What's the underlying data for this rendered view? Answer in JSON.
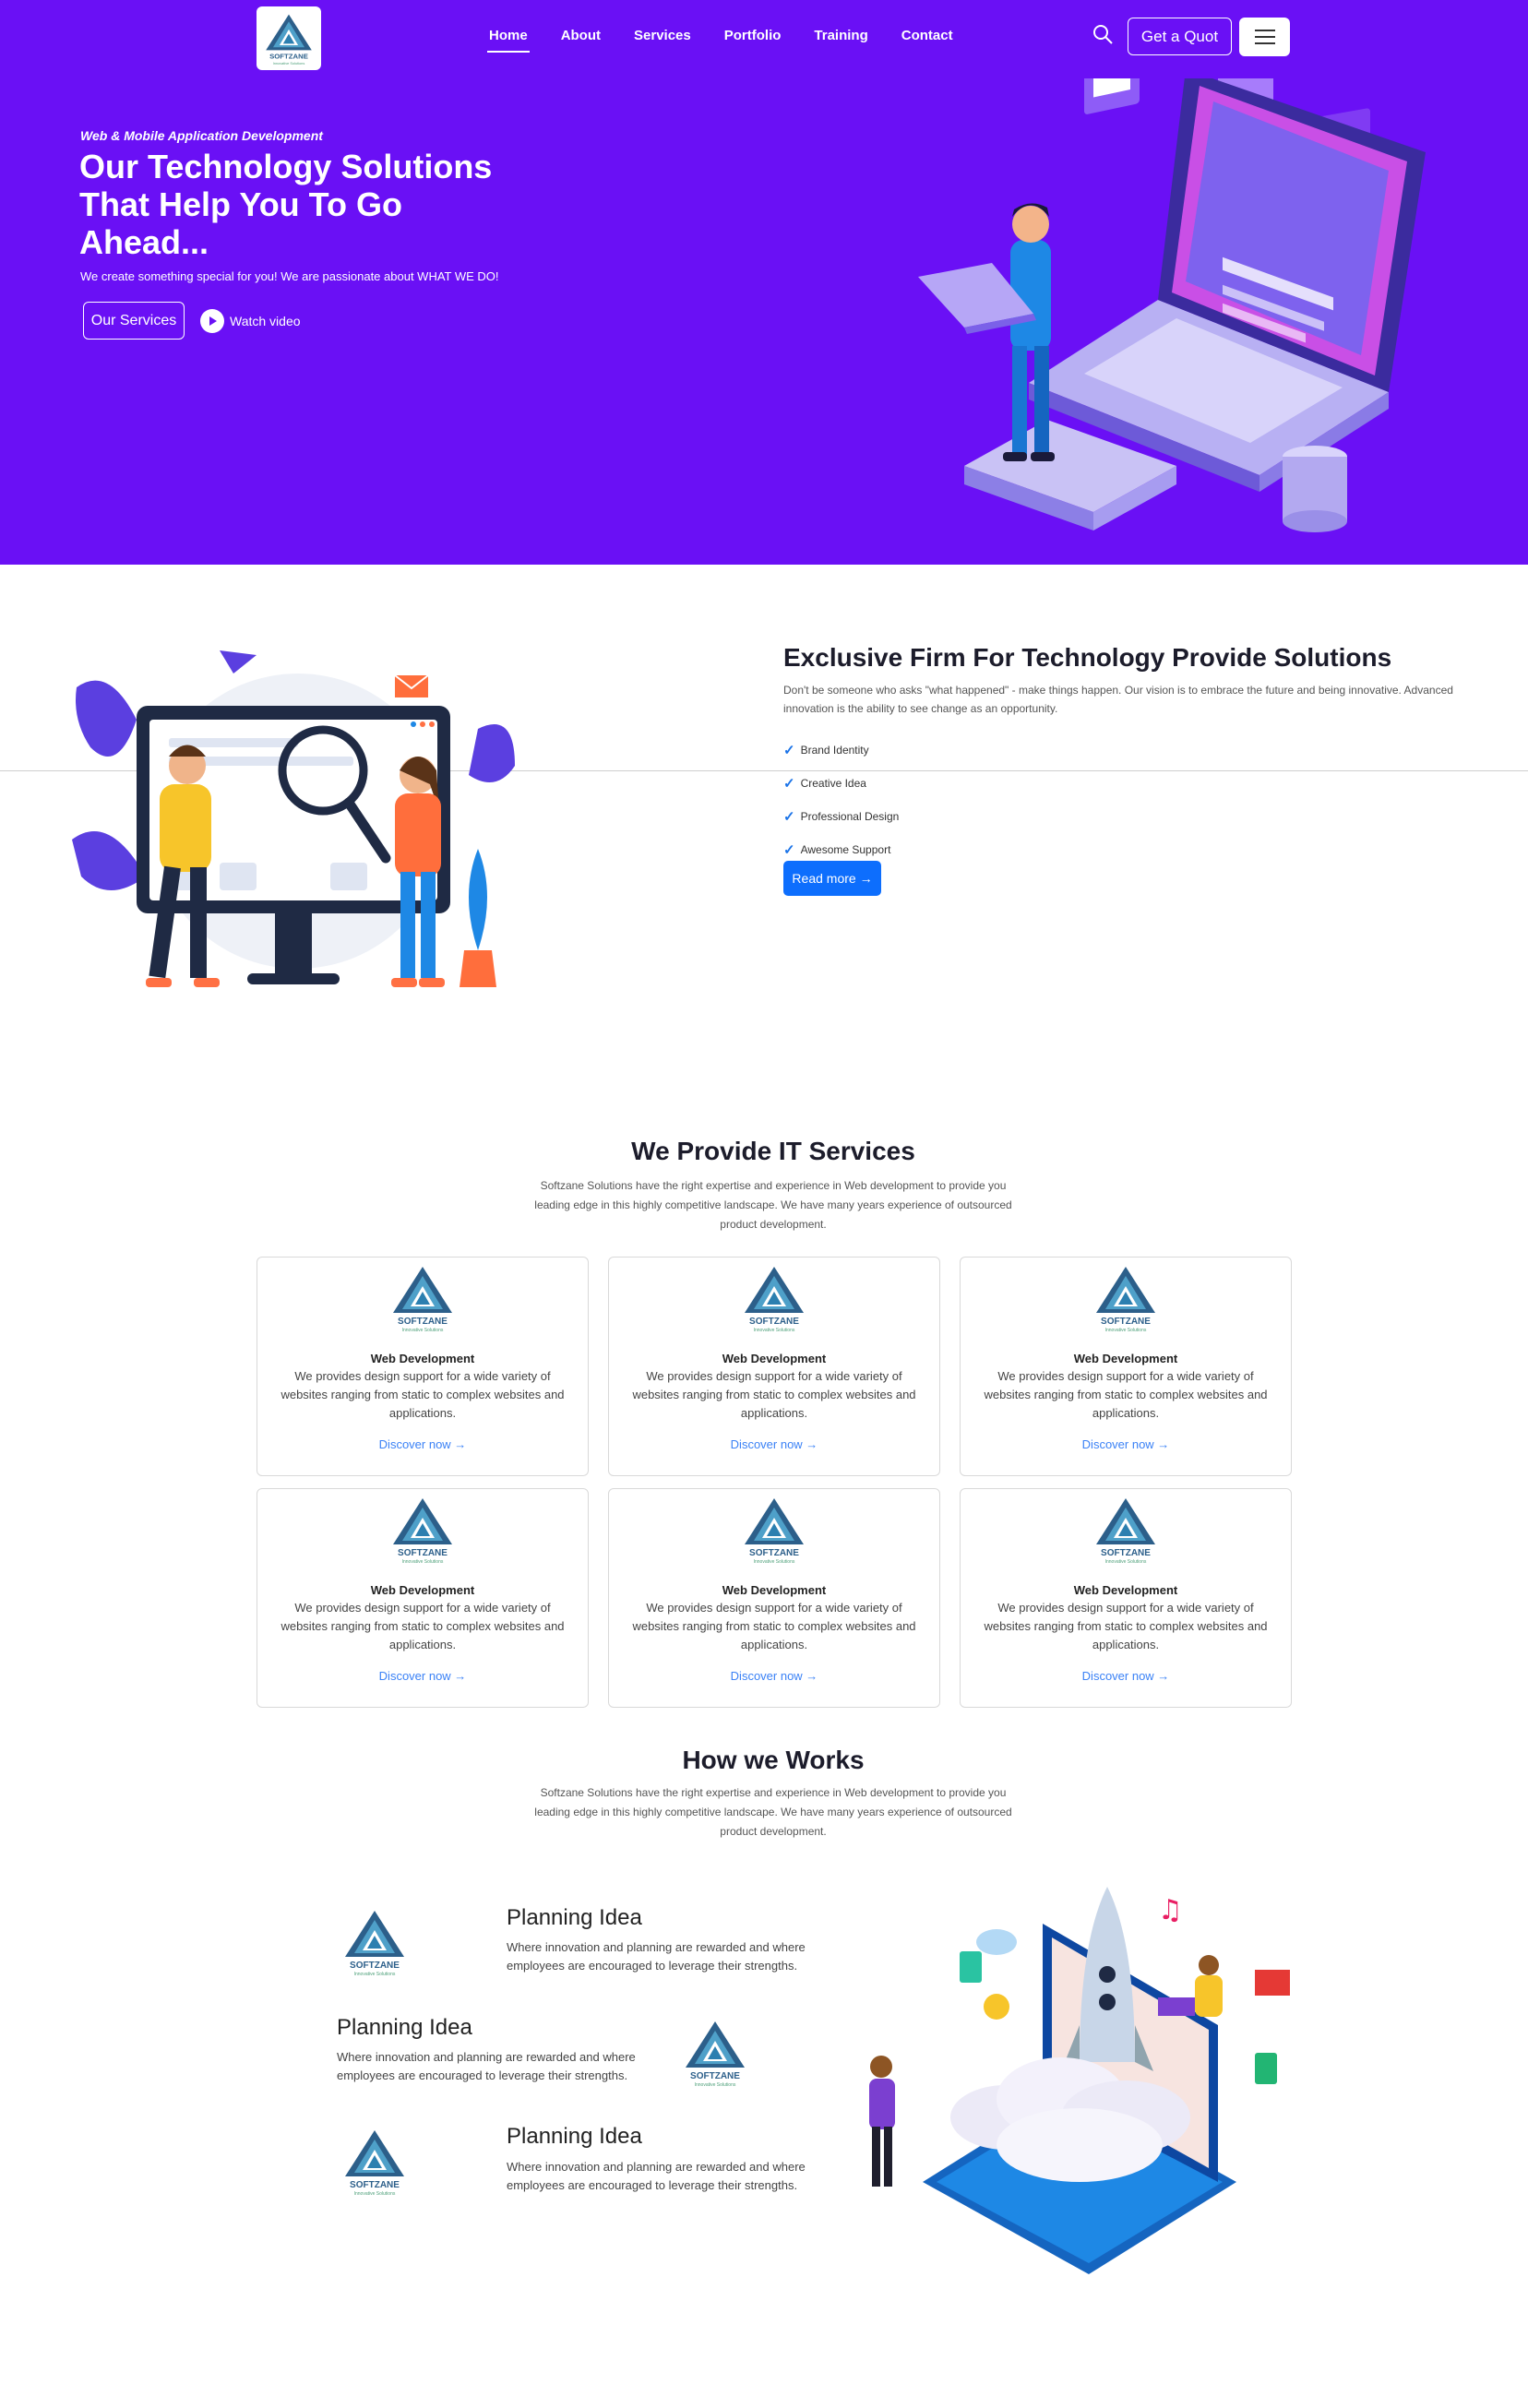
{
  "header": {
    "logo_alt": "SOFTZANE",
    "nav": [
      "Home",
      "About",
      "Services",
      "Portfolio",
      "Training",
      "Contact"
    ],
    "quote_label": "Get a Quot"
  },
  "hero": {
    "kicker": "Web & Mobile Application Development",
    "title": "Our Technology Solutions That Help You To Go Ahead...",
    "subtitle": "We create something special for you! We are passionate about WHAT WE DO!",
    "services_button": "Our Services",
    "watch_label": "Watch video",
    "bg_color": "#6a10f5"
  },
  "about": {
    "title": "Exclusive Firm For Technology Provide Solutions",
    "description": "Don't be someone who asks \"what happened\" - make things happen. Our vision is to embrace the future and being innovative. Advanced innovation is the ability to see change as an opportunity.",
    "items": [
      "Brand Identity",
      "Creative Idea",
      "Professional Design",
      "Awesome Support"
    ],
    "button": "Read more →"
  },
  "services": {
    "title": "We Provide IT Services",
    "description": "Softzane Solutions have the right expertise and experience in Web development to provide you leading edge in this highly competitive landscape. We have many years experience of outsourced product development.",
    "cards": [
      {
        "title": "Web Development",
        "text": "We provides design support for a wide variety of websites ranging from static to complex websites and applications.",
        "link": "Discover now →"
      },
      {
        "title": "Web Development",
        "text": "We provides design support for a wide variety of websites ranging from static to complex websites and applications.",
        "link": "Discover now →"
      },
      {
        "title": "Web Development",
        "text": "We provides design support for a wide variety of websites ranging from static to complex websites and applications.",
        "link": "Discover now →"
      },
      {
        "title": "Web Development",
        "text": "We provides design support for a wide variety of websites ranging from static to complex websites and applications.",
        "link": "Discover now →"
      },
      {
        "title": "Web Development",
        "text": "We provides design support for a wide variety of websites ranging from static to complex websites and applications.",
        "link": "Discover now →"
      },
      {
        "title": "Web Development",
        "text": "We provides design support for a wide variety of websites ranging from static to complex websites and applications.",
        "link": "Discover now →"
      }
    ]
  },
  "how": {
    "title": "How we Works",
    "description": "Softzane Solutions have the right expertise and experience in Web development to provide you leading edge in this highly competitive landscape. We have many years experience of outsourced product development.",
    "steps": [
      {
        "title": "Planning Idea",
        "text": "Where innovation and planning are rewarded and where employees are encouraged to leverage their strengths."
      },
      {
        "title": "Planning Idea",
        "text": "Where innovation and planning are rewarded and where employees are encouraged to leverage their strengths."
      },
      {
        "title": "Planning Idea",
        "text": "Where innovation and planning are rewarded and where employees are encouraged to leverage their strengths."
      }
    ]
  },
  "icons": {
    "search": "search-icon",
    "menu": "hamburger-menu-icon",
    "play": "play-icon",
    "check": "checkmark-icon"
  }
}
